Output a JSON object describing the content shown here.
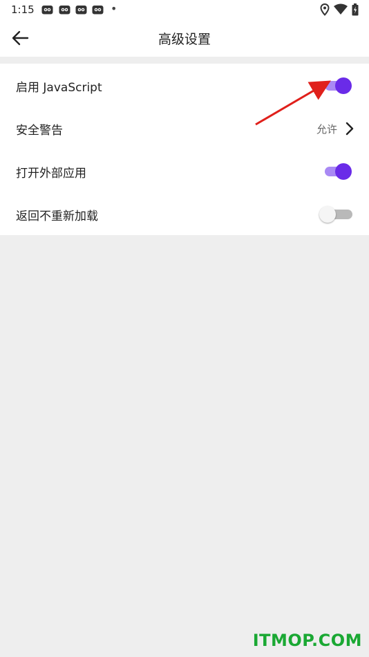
{
  "status_bar": {
    "time": "1:15",
    "dot": "•",
    "icons_left": [
      "notification-icon",
      "notification-icon",
      "notification-icon",
      "notification-icon"
    ],
    "icons_right": [
      "location-icon",
      "wifi-icon",
      "battery-icon"
    ]
  },
  "app_bar": {
    "title": "高级设置",
    "back_icon": "arrow-left-icon"
  },
  "settings": {
    "items": [
      {
        "label": "启用 JavaScript",
        "control": "toggle",
        "on": true
      },
      {
        "label": "安全警告",
        "control": "value",
        "value": "允许",
        "icon": "chevron-right-icon"
      },
      {
        "label": "打开外部应用",
        "control": "toggle",
        "on": true
      },
      {
        "label": "返回不重新加载",
        "control": "toggle",
        "on": false
      }
    ]
  },
  "annotation": {
    "icon": "red-arrow-icon",
    "color": "#e0201b"
  },
  "watermark": {
    "text": "ITMOP.COM",
    "color": "#1aa833"
  },
  "colors": {
    "accent": "#6a2be8",
    "accent_track": "#a989f4",
    "background": "#eeeeee"
  }
}
